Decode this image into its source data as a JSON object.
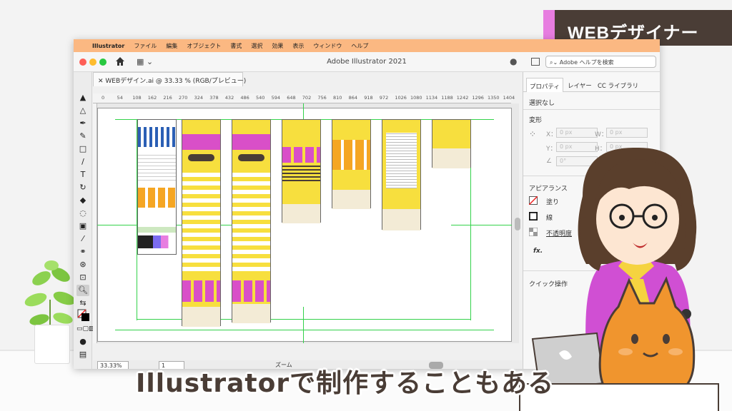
{
  "badge": {
    "label": "WEBデザイナー"
  },
  "subtitle": "Illustratorで制作することもある",
  "menubar": {
    "items": [
      "Illustrator",
      "ファイル",
      "編集",
      "オブジェクト",
      "書式",
      "選択",
      "効果",
      "表示",
      "ウィンドウ",
      "ヘルプ"
    ]
  },
  "window": {
    "title": "Adobe Illustrator 2021",
    "search_placeholder": "Adobe ヘルプを検索",
    "doc_tab": "WEBデザイン.ai @ 33.33 % (RGB/プレビュー)"
  },
  "ruler": {
    "ticks": [
      "0",
      "54",
      "108",
      "162",
      "216",
      "270",
      "324",
      "378",
      "432",
      "486",
      "540",
      "594",
      "648",
      "702",
      "756",
      "810",
      "864",
      "918",
      "972",
      "1026",
      "1080",
      "1134",
      "1188",
      "1242",
      "1296",
      "1350",
      "1404"
    ]
  },
  "status": {
    "zoom": "33.33%",
    "page": "1",
    "zoom_label": "ズーム"
  },
  "panel": {
    "tabs": [
      "プロパティ",
      "レイヤー",
      "CC ライブラリ"
    ],
    "selection": "選択なし",
    "transform_title": "変形",
    "x_label": "X：",
    "x_value": "0 px",
    "y_label": "Y：",
    "y_value": "0 px",
    "w_label": "W：",
    "w_value": "0 px",
    "h_label": "H：",
    "h_value": "0 px",
    "angle_value": "0°",
    "appearance_title": "アピアランス",
    "fill_label": "塗り",
    "stroke_label": "線",
    "opacity_label": "不透明度",
    "opacity_value": "10",
    "fx_label": "fx.",
    "quick_title": "クイック操作"
  },
  "colors": {
    "menubar": "#fbb882",
    "badge_accent": "#e77de0",
    "badge_dark": "#4a3d36",
    "guide": "#33d24a",
    "page_yellow": "#f7df3e"
  }
}
